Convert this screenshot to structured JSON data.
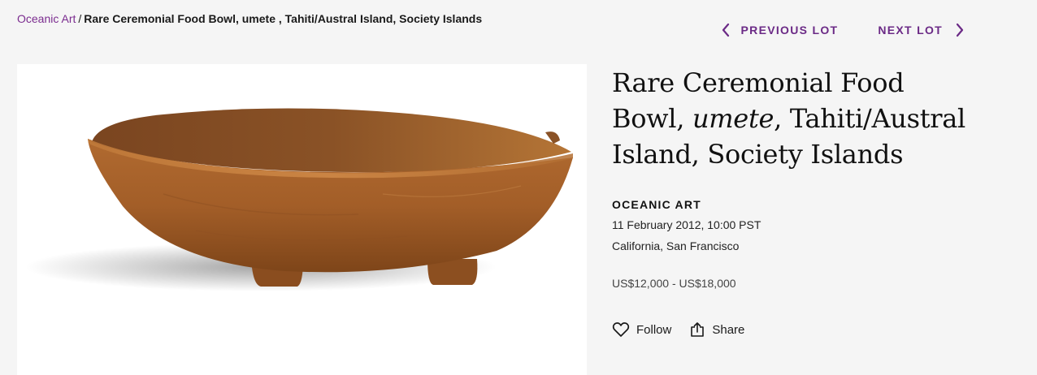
{
  "breadcrumb": {
    "category": "Oceanic Art",
    "separator": "/",
    "current": "Rare Ceremonial Food Bowl, umete , Tahiti/Austral Island, Society Islands"
  },
  "lot_nav": {
    "previous_label": "PREVIOUS LOT",
    "next_label": "NEXT LOT"
  },
  "lot": {
    "title_part1": "Rare Ceremonial Food Bowl, ",
    "title_italic": "umete",
    "title_part2": ", Tahiti/Austral Island, Society Islands",
    "department": "OCEANIC ART",
    "date": "11 February 2012, 10:00 PST",
    "location": "California, San Francisco",
    "estimate": "US$12,000 - US$18,000"
  },
  "actions": {
    "follow_label": "Follow",
    "share_label": "Share"
  },
  "colors": {
    "accent": "#7b2c8f",
    "background": "#f5f5f5",
    "wood": "#a8642e"
  },
  "icons": [
    "chevron-left-icon",
    "chevron-right-icon",
    "heart-icon",
    "share-icon"
  ]
}
